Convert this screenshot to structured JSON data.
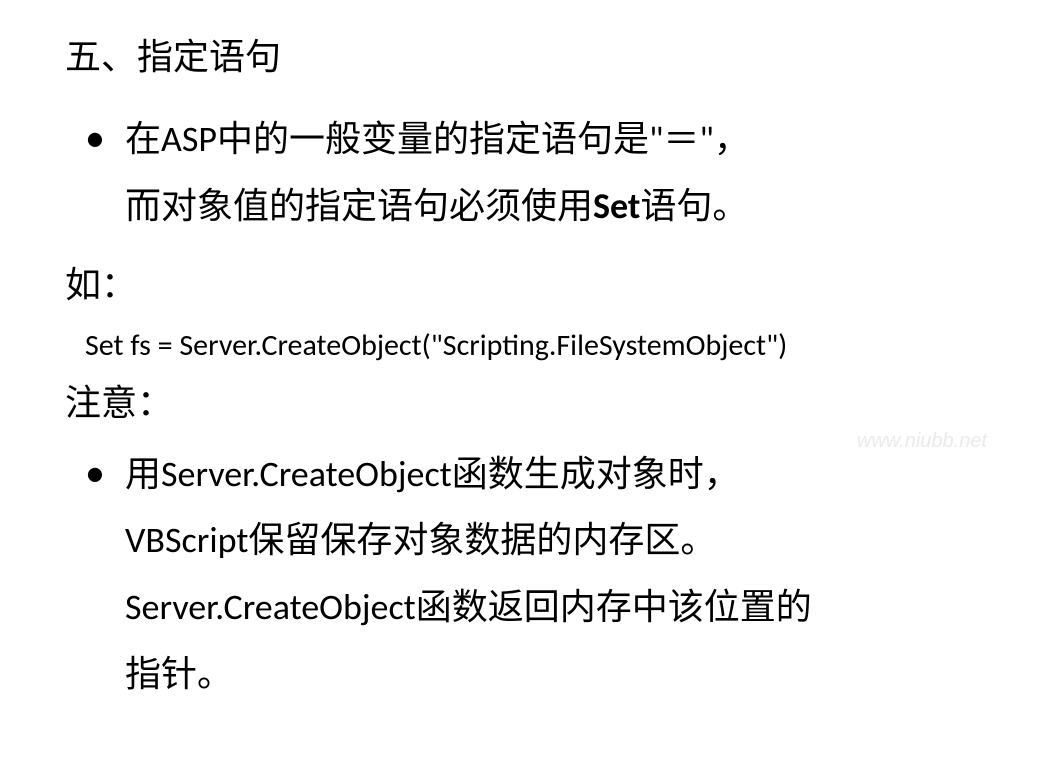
{
  "heading": "五、指定语句",
  "bullet1_part1": "在ASP中的一般变量的指定语句是\"＝\"，",
  "bullet1_part2_pre": "而对象值的指定语句必须使用",
  "bullet1_part2_bold": "Set",
  "bullet1_part2_post": "语句。",
  "label_example": "如：",
  "code_example": "Set  fs = Server.CreateObject(\"Scripting.FileSystemObject\")",
  "label_note": "注意：",
  "bullet2_line1": "用Server.CreateObject函数生成对象时，",
  "bullet2_line2": "VBScript保留保存对象数据的内存区。",
  "bullet2_line3": "Server.CreateObject函数返回内存中该位置的",
  "bullet2_line4": "指针。",
  "watermark": "www.niubb.net"
}
